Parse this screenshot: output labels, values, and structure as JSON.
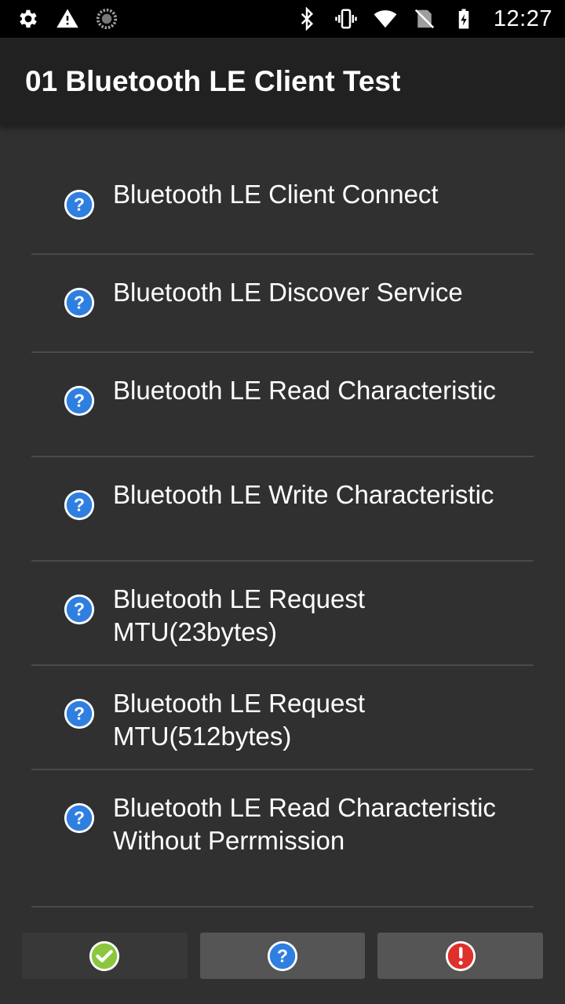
{
  "status_bar": {
    "time": "12:27",
    "left_icons": [
      "gear-icon",
      "warning-icon",
      "sync-icon"
    ],
    "right_icons": [
      "bluetooth-icon",
      "vibrate-icon",
      "wifi-icon",
      "no-sim-icon",
      "battery-charging-icon"
    ]
  },
  "app_bar": {
    "title": "01 Bluetooth LE Client Test"
  },
  "tests": [
    {
      "label": "Bluetooth LE Client Connect",
      "status_icon": "question-icon"
    },
    {
      "label": "Bluetooth LE Discover Service",
      "status_icon": "question-icon"
    },
    {
      "label": "Bluetooth LE Read Characteristic",
      "status_icon": "question-icon"
    },
    {
      "label": "Bluetooth LE Write Characteristic",
      "status_icon": "question-icon"
    },
    {
      "label": "Bluetooth LE Request MTU(23bytes)",
      "status_icon": "question-icon"
    },
    {
      "label": "Bluetooth LE Request MTU(512bytes)",
      "status_icon": "question-icon"
    },
    {
      "label": "Bluetooth LE Read Characteristic Without Perrmission",
      "status_icon": "question-icon"
    }
  ],
  "bottom_bar": {
    "pass_icon": "check-icon",
    "info_icon": "question-icon",
    "fail_icon": "error-icon"
  },
  "colors": {
    "background": "#303030",
    "app_bar": "#212121",
    "status_bar": "#000000",
    "divider": "#4a4a4a",
    "button_pass": "#383838",
    "button": "#555555",
    "icon_blue": "#2f7fe0",
    "icon_green": "#8cc63f",
    "icon_red": "#e0302b"
  }
}
